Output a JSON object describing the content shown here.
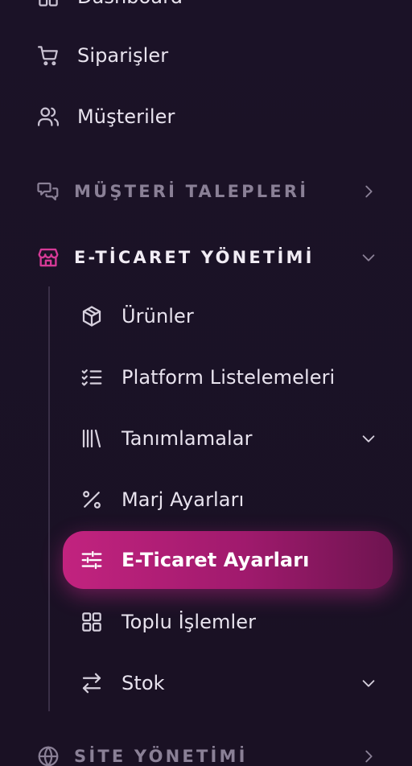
{
  "menu": {
    "dashboard": {
      "label": "Dashboard",
      "icon": "grid-icon"
    },
    "orders": {
      "label": "Siparişler",
      "icon": "cart-icon"
    },
    "customers": {
      "label": "Müşteriler",
      "icon": "users-icon"
    },
    "customer_requests": {
      "label": "MÜŞTERİ TALEPLERİ",
      "icon": "chat-icon"
    },
    "ecommerce": {
      "label": "E-TİCARET YÖNETİMİ",
      "icon": "store-icon",
      "items": [
        {
          "label": "Ürünler",
          "icon": "box-icon"
        },
        {
          "label": "Platform Listelemeleri",
          "icon": "checklist-icon"
        },
        {
          "label": "Tanımlamalar",
          "icon": "library-icon"
        },
        {
          "label": "Marj Ayarları",
          "icon": "percent-icon"
        },
        {
          "label": "E-Ticaret Ayarları",
          "icon": "sliders-icon"
        },
        {
          "label": "Toplu İşlemler",
          "icon": "grid-icon"
        },
        {
          "label": "Stok",
          "icon": "arrows-swap-icon"
        }
      ]
    },
    "site_management": {
      "label": "SİTE YÖNETİMİ",
      "icon": "globe-icon"
    }
  },
  "colors": {
    "background": "#1a1226",
    "accent": "#d63a97",
    "active_gradient_start": "#c2237f",
    "active_gradient_end": "#6e1450",
    "muted": "#8a8096",
    "text": "#e8e3ee"
  }
}
